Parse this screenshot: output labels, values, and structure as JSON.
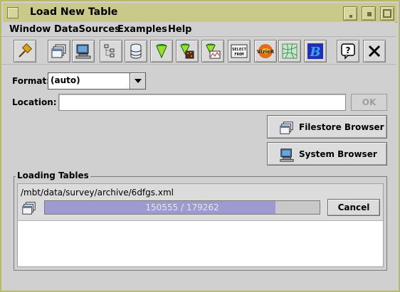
{
  "window": {
    "title": "Load New Table",
    "controls": [
      "minimize-button",
      "maximize-button",
      "close-button"
    ]
  },
  "menubar": {
    "items": [
      {
        "label": "Window"
      },
      {
        "label": "DataSources"
      },
      {
        "label": "Examples"
      },
      {
        "label": "Help"
      }
    ]
  },
  "toolbar": {
    "icons": [
      "pushpin-icon",
      "windows-stack-icon",
      "computer-icon",
      "tree-icon",
      "database-icon",
      "cone-filter-icon",
      "cone-dice-icon",
      "cone-chart-icon",
      "select-from-icon",
      "vizier-icon",
      "sky-map-icon",
      "b-icon",
      "help-icon",
      "close-icon"
    ],
    "select_label": "SELECT FROM",
    "vizier_label": "VizieR",
    "b_label": "B",
    "help_label": "?"
  },
  "form": {
    "format_label": "Format:",
    "format_value": "(auto)",
    "location_label": "Location:",
    "location_value": "",
    "ok_label": "OK",
    "filestore_label": "Filestore Browser",
    "system_label": "System Browser"
  },
  "loading": {
    "group_title": "Loading Tables",
    "path": "/mbt/data/survey/archive/6dfgs.xml",
    "progress_text": "150555 / 179262",
    "progress_current": 150555,
    "progress_total": 179262,
    "cancel_label": "Cancel"
  },
  "colors": {
    "titlebar": "#c9c98a",
    "progress_fill": "#9b9bcf",
    "background": "#d0d0d0"
  }
}
